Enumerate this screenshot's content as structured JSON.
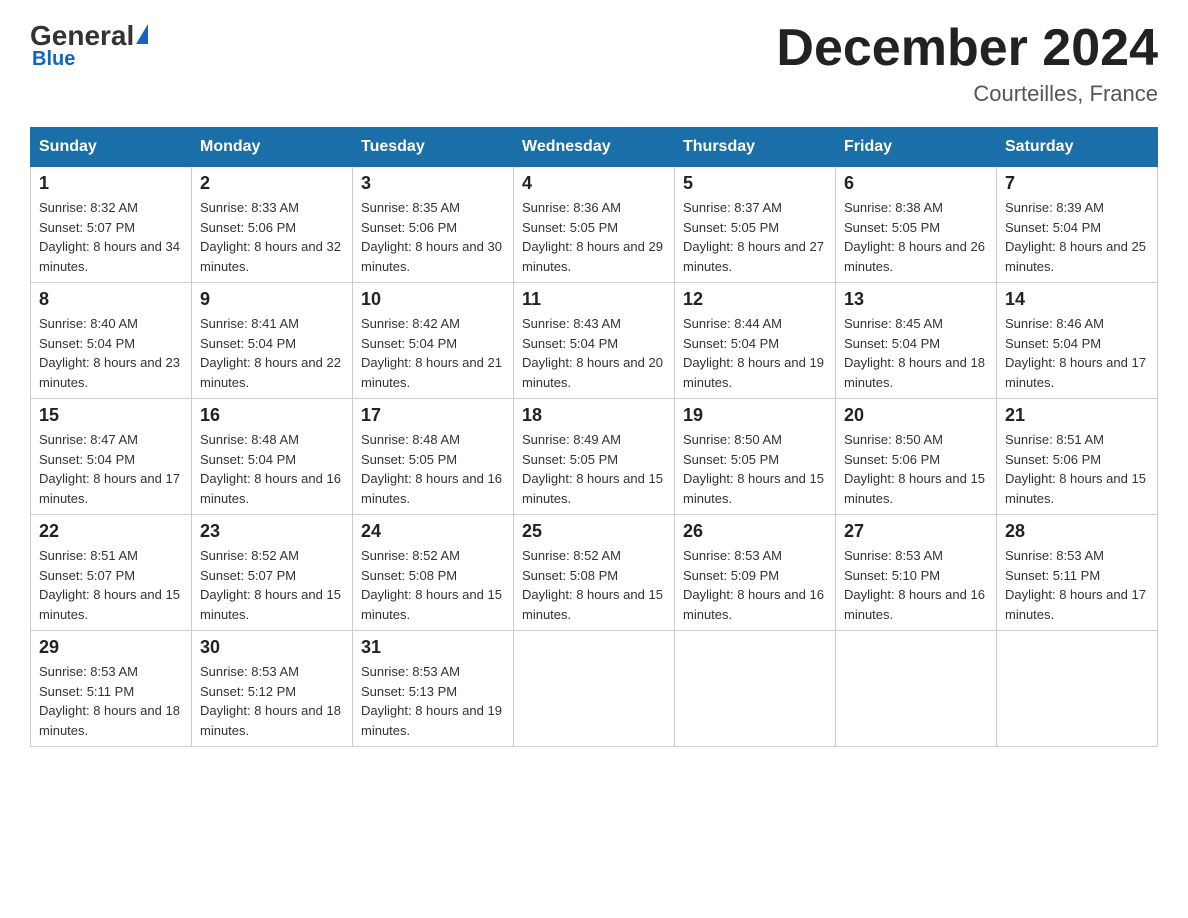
{
  "logo": {
    "general": "General",
    "blue": "Blue"
  },
  "title": "December 2024",
  "location": "Courteilles, France",
  "days_of_week": [
    "Sunday",
    "Monday",
    "Tuesday",
    "Wednesday",
    "Thursday",
    "Friday",
    "Saturday"
  ],
  "weeks": [
    [
      {
        "day": "1",
        "sunrise": "8:32 AM",
        "sunset": "5:07 PM",
        "daylight": "8 hours and 34 minutes."
      },
      {
        "day": "2",
        "sunrise": "8:33 AM",
        "sunset": "5:06 PM",
        "daylight": "8 hours and 32 minutes."
      },
      {
        "day": "3",
        "sunrise": "8:35 AM",
        "sunset": "5:06 PM",
        "daylight": "8 hours and 30 minutes."
      },
      {
        "day": "4",
        "sunrise": "8:36 AM",
        "sunset": "5:05 PM",
        "daylight": "8 hours and 29 minutes."
      },
      {
        "day": "5",
        "sunrise": "8:37 AM",
        "sunset": "5:05 PM",
        "daylight": "8 hours and 27 minutes."
      },
      {
        "day": "6",
        "sunrise": "8:38 AM",
        "sunset": "5:05 PM",
        "daylight": "8 hours and 26 minutes."
      },
      {
        "day": "7",
        "sunrise": "8:39 AM",
        "sunset": "5:04 PM",
        "daylight": "8 hours and 25 minutes."
      }
    ],
    [
      {
        "day": "8",
        "sunrise": "8:40 AM",
        "sunset": "5:04 PM",
        "daylight": "8 hours and 23 minutes."
      },
      {
        "day": "9",
        "sunrise": "8:41 AM",
        "sunset": "5:04 PM",
        "daylight": "8 hours and 22 minutes."
      },
      {
        "day": "10",
        "sunrise": "8:42 AM",
        "sunset": "5:04 PM",
        "daylight": "8 hours and 21 minutes."
      },
      {
        "day": "11",
        "sunrise": "8:43 AM",
        "sunset": "5:04 PM",
        "daylight": "8 hours and 20 minutes."
      },
      {
        "day": "12",
        "sunrise": "8:44 AM",
        "sunset": "5:04 PM",
        "daylight": "8 hours and 19 minutes."
      },
      {
        "day": "13",
        "sunrise": "8:45 AM",
        "sunset": "5:04 PM",
        "daylight": "8 hours and 18 minutes."
      },
      {
        "day": "14",
        "sunrise": "8:46 AM",
        "sunset": "5:04 PM",
        "daylight": "8 hours and 17 minutes."
      }
    ],
    [
      {
        "day": "15",
        "sunrise": "8:47 AM",
        "sunset": "5:04 PM",
        "daylight": "8 hours and 17 minutes."
      },
      {
        "day": "16",
        "sunrise": "8:48 AM",
        "sunset": "5:04 PM",
        "daylight": "8 hours and 16 minutes."
      },
      {
        "day": "17",
        "sunrise": "8:48 AM",
        "sunset": "5:05 PM",
        "daylight": "8 hours and 16 minutes."
      },
      {
        "day": "18",
        "sunrise": "8:49 AM",
        "sunset": "5:05 PM",
        "daylight": "8 hours and 15 minutes."
      },
      {
        "day": "19",
        "sunrise": "8:50 AM",
        "sunset": "5:05 PM",
        "daylight": "8 hours and 15 minutes."
      },
      {
        "day": "20",
        "sunrise": "8:50 AM",
        "sunset": "5:06 PM",
        "daylight": "8 hours and 15 minutes."
      },
      {
        "day": "21",
        "sunrise": "8:51 AM",
        "sunset": "5:06 PM",
        "daylight": "8 hours and 15 minutes."
      }
    ],
    [
      {
        "day": "22",
        "sunrise": "8:51 AM",
        "sunset": "5:07 PM",
        "daylight": "8 hours and 15 minutes."
      },
      {
        "day": "23",
        "sunrise": "8:52 AM",
        "sunset": "5:07 PM",
        "daylight": "8 hours and 15 minutes."
      },
      {
        "day": "24",
        "sunrise": "8:52 AM",
        "sunset": "5:08 PM",
        "daylight": "8 hours and 15 minutes."
      },
      {
        "day": "25",
        "sunrise": "8:52 AM",
        "sunset": "5:08 PM",
        "daylight": "8 hours and 15 minutes."
      },
      {
        "day": "26",
        "sunrise": "8:53 AM",
        "sunset": "5:09 PM",
        "daylight": "8 hours and 16 minutes."
      },
      {
        "day": "27",
        "sunrise": "8:53 AM",
        "sunset": "5:10 PM",
        "daylight": "8 hours and 16 minutes."
      },
      {
        "day": "28",
        "sunrise": "8:53 AM",
        "sunset": "5:11 PM",
        "daylight": "8 hours and 17 minutes."
      }
    ],
    [
      {
        "day": "29",
        "sunrise": "8:53 AM",
        "sunset": "5:11 PM",
        "daylight": "8 hours and 18 minutes."
      },
      {
        "day": "30",
        "sunrise": "8:53 AM",
        "sunset": "5:12 PM",
        "daylight": "8 hours and 18 minutes."
      },
      {
        "day": "31",
        "sunrise": "8:53 AM",
        "sunset": "5:13 PM",
        "daylight": "8 hours and 19 minutes."
      },
      null,
      null,
      null,
      null
    ]
  ]
}
